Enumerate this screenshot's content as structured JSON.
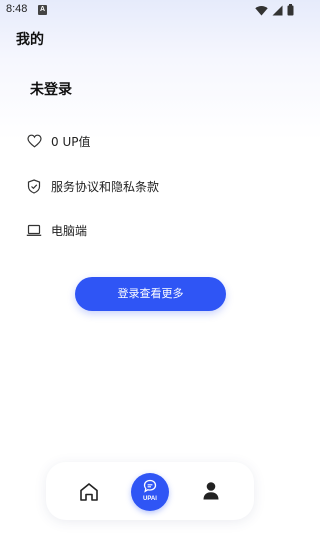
{
  "status_bar": {
    "time": "8:48",
    "notification_letter": "A",
    "icons": [
      "wifi-icon",
      "signal-icon",
      "battery-icon"
    ]
  },
  "header": {
    "title": "我的"
  },
  "account": {
    "login_status": "未登录"
  },
  "menu": {
    "items": [
      {
        "icon": "heart-icon",
        "label": "0 UP值"
      },
      {
        "icon": "shield-check-icon",
        "label": "服务协议和隐私条款"
      },
      {
        "icon": "laptop-icon",
        "label": "电脑端"
      }
    ]
  },
  "cta": {
    "login_label": "登录查看更多"
  },
  "bottom_nav": {
    "items": [
      {
        "icon": "home-icon"
      },
      {
        "icon": "chat-bubble-icon",
        "label": "UPAI"
      },
      {
        "icon": "person-icon"
      }
    ]
  },
  "colors": {
    "accent": "#2f55f5",
    "background_top": "#e6ebfb",
    "text": "#111111"
  }
}
